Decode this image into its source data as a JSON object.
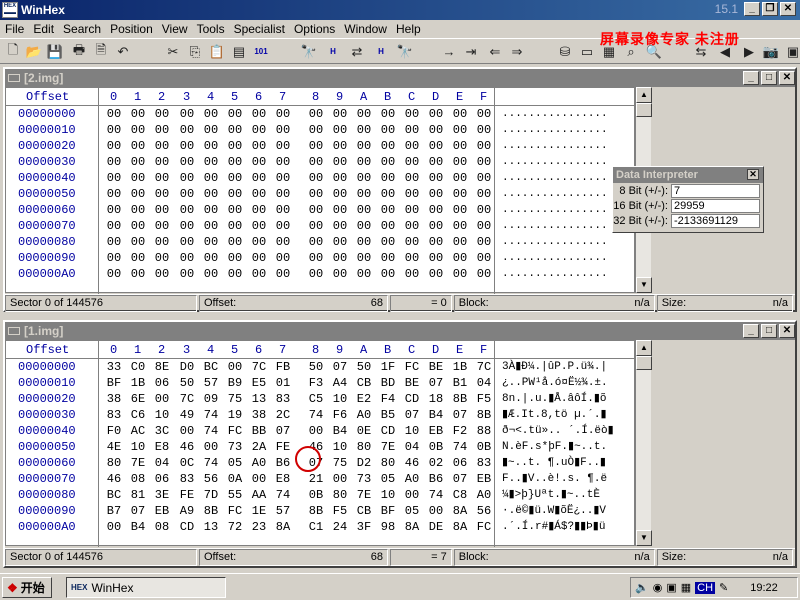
{
  "app": {
    "title": "WinHex",
    "version": "15.1",
    "icon_text": "HEX"
  },
  "menu": [
    "File",
    "Edit",
    "Search",
    "Position",
    "View",
    "Tools",
    "Specialist",
    "Options",
    "Window",
    "Help"
  ],
  "watermark": "屏幕录像专家 未注册",
  "toolbar_icons": [
    "new-file-icon",
    "open-folder-icon",
    "save-icon",
    "print-icon",
    "properties-icon",
    "undo-icon",
    "cut-icon",
    "copy-icon",
    "paste-icon",
    "write-block-icon",
    "binary-icon",
    "find-text-icon",
    "find-hex-icon",
    "replace-text-icon",
    "replace-hex-icon",
    "find-next-icon",
    "goto-offset-icon",
    "goto-sector-icon",
    "back-icon",
    "forward-icon",
    "disk-icon",
    "ram-icon",
    "calculator-icon",
    "bookmark-icon",
    "search-icon",
    "compare-icon",
    "prev-icon",
    "next-icon",
    "camera-icon",
    "view-icon"
  ],
  "hex_header": {
    "offset": "Offset",
    "columns": [
      "0",
      "1",
      "2",
      "3",
      "4",
      "5",
      "6",
      "7",
      "8",
      "9",
      "A",
      "B",
      "C",
      "D",
      "E",
      "F"
    ]
  },
  "window1": {
    "title": "[2.img]",
    "rows": [
      {
        "offset": "00000000",
        "bytes": [
          "00",
          "00",
          "00",
          "00",
          "00",
          "00",
          "00",
          "00",
          "00",
          "00",
          "00",
          "00",
          "00",
          "00",
          "00",
          "00"
        ],
        "ascii": "................"
      },
      {
        "offset": "00000010",
        "bytes": [
          "00",
          "00",
          "00",
          "00",
          "00",
          "00",
          "00",
          "00",
          "00",
          "00",
          "00",
          "00",
          "00",
          "00",
          "00",
          "00"
        ],
        "ascii": "................"
      },
      {
        "offset": "00000020",
        "bytes": [
          "00",
          "00",
          "00",
          "00",
          "00",
          "00",
          "00",
          "00",
          "00",
          "00",
          "00",
          "00",
          "00",
          "00",
          "00",
          "00"
        ],
        "ascii": "................"
      },
      {
        "offset": "00000030",
        "bytes": [
          "00",
          "00",
          "00",
          "00",
          "00",
          "00",
          "00",
          "00",
          "00",
          "00",
          "00",
          "00",
          "00",
          "00",
          "00",
          "00"
        ],
        "ascii": "................"
      },
      {
        "offset": "00000040",
        "bytes": [
          "00",
          "00",
          "00",
          "00",
          "00",
          "00",
          "00",
          "00",
          "00",
          "00",
          "00",
          "00",
          "00",
          "00",
          "00",
          "00"
        ],
        "ascii": "................"
      },
      {
        "offset": "00000050",
        "bytes": [
          "00",
          "00",
          "00",
          "00",
          "00",
          "00",
          "00",
          "00",
          "00",
          "00",
          "00",
          "00",
          "00",
          "00",
          "00",
          "00"
        ],
        "ascii": "................"
      },
      {
        "offset": "00000060",
        "bytes": [
          "00",
          "00",
          "00",
          "00",
          "00",
          "00",
          "00",
          "00",
          "00",
          "00",
          "00",
          "00",
          "00",
          "00",
          "00",
          "00"
        ],
        "ascii": "................"
      },
      {
        "offset": "00000070",
        "bytes": [
          "00",
          "00",
          "00",
          "00",
          "00",
          "00",
          "00",
          "00",
          "00",
          "00",
          "00",
          "00",
          "00",
          "00",
          "00",
          "00"
        ],
        "ascii": "................"
      },
      {
        "offset": "00000080",
        "bytes": [
          "00",
          "00",
          "00",
          "00",
          "00",
          "00",
          "00",
          "00",
          "00",
          "00",
          "00",
          "00",
          "00",
          "00",
          "00",
          "00"
        ],
        "ascii": "................"
      },
      {
        "offset": "00000090",
        "bytes": [
          "00",
          "00",
          "00",
          "00",
          "00",
          "00",
          "00",
          "00",
          "00",
          "00",
          "00",
          "00",
          "00",
          "00",
          "00",
          "00"
        ],
        "ascii": "................"
      },
      {
        "offset": "000000A0",
        "bytes": [
          "00",
          "00",
          "00",
          "00",
          "00",
          "00",
          "00",
          "00",
          "00",
          "00",
          "00",
          "00",
          "00",
          "00",
          "00",
          "00"
        ],
        "ascii": "................"
      }
    ],
    "status": {
      "sector": "Sector 0 of 144576",
      "offset_label": "Offset:",
      "offset_value": "68",
      "eq": "= 0",
      "block_label": "Block:",
      "block_value": "n/a",
      "size_label": "Size:",
      "size_value": "n/a"
    }
  },
  "window2": {
    "title": "[1.img]",
    "rows": [
      {
        "offset": "00000000",
        "bytes": [
          "33",
          "C0",
          "8E",
          "D0",
          "BC",
          "00",
          "7C",
          "FB",
          "50",
          "07",
          "50",
          "1F",
          "FC",
          "BE",
          "1B",
          "7C"
        ],
        "ascii": "3À▮Ð¼.|ûP.P.ü¾.|"
      },
      {
        "offset": "00000010",
        "bytes": [
          "BF",
          "1B",
          "06",
          "50",
          "57",
          "B9",
          "E5",
          "01",
          "F3",
          "A4",
          "CB",
          "BD",
          "BE",
          "07",
          "B1",
          "04"
        ],
        "ascii": "¿..PW¹å.ó¤Ë½¾.±."
      },
      {
        "offset": "00000020",
        "bytes": [
          "38",
          "6E",
          "00",
          "7C",
          "09",
          "75",
          "13",
          "83",
          "C5",
          "10",
          "E2",
          "F4",
          "CD",
          "18",
          "8B",
          "F5"
        ],
        "ascii": "8n.|.u.▮Å.âôÍ.▮õ"
      },
      {
        "offset": "00000030",
        "bytes": [
          "83",
          "C6",
          "10",
          "49",
          "74",
          "19",
          "38",
          "2C",
          "74",
          "F6",
          "A0",
          "B5",
          "07",
          "B4",
          "07",
          "8B"
        ],
        "ascii": "▮Æ.It.8,tö µ.´.▮"
      },
      {
        "offset": "00000040",
        "bytes": [
          "F0",
          "AC",
          "3C",
          "00",
          "74",
          "FC",
          "BB",
          "07",
          "00",
          "B4",
          "0E",
          "CD",
          "10",
          "EB",
          "F2",
          "88"
        ],
        "ascii": "ð¬<.tü».. ´.Í.ëò▮"
      },
      {
        "offset": "00000050",
        "bytes": [
          "4E",
          "10",
          "E8",
          "46",
          "00",
          "73",
          "2A",
          "FE",
          "46",
          "10",
          "80",
          "7E",
          "04",
          "0B",
          "74",
          "0B"
        ],
        "ascii": "N.èF.s*þF.▮~..t."
      },
      {
        "offset": "00000060",
        "bytes": [
          "80",
          "7E",
          "04",
          "0C",
          "74",
          "05",
          "A0",
          "B6",
          "07",
          "75",
          "D2",
          "80",
          "46",
          "02",
          "06",
          "83"
        ],
        "ascii": "▮~..t. ¶.uÒ▮F..▮"
      },
      {
        "offset": "00000070",
        "bytes": [
          "46",
          "08",
          "06",
          "83",
          "56",
          "0A",
          "00",
          "E8",
          "21",
          "00",
          "73",
          "05",
          "A0",
          "B6",
          "07",
          "EB"
        ],
        "ascii": "F..▮V..è!.s. ¶.ë"
      },
      {
        "offset": "00000080",
        "bytes": [
          "BC",
          "81",
          "3E",
          "FE",
          "7D",
          "55",
          "AA",
          "74",
          "0B",
          "80",
          "7E",
          "10",
          "00",
          "74",
          "C8",
          "A0"
        ],
        "ascii": "¼▮>þ}Uªt.▮~..tÈ "
      },
      {
        "offset": "00000090",
        "bytes": [
          "B7",
          "07",
          "EB",
          "A9",
          "8B",
          "FC",
          "1E",
          "57",
          "8B",
          "F5",
          "CB",
          "BF",
          "05",
          "00",
          "8A",
          "56"
        ],
        "ascii": "·.ë©▮ü.W▮õË¿..▮V"
      },
      {
        "offset": "000000A0",
        "bytes": [
          "00",
          "B4",
          "08",
          "CD",
          "13",
          "72",
          "23",
          "8A",
          "C1",
          "24",
          "3F",
          "98",
          "8A",
          "DE",
          "8A",
          "FC"
        ],
        "ascii": ".´.Í.r#▮Á$?▮▮Þ▮ü"
      }
    ],
    "status": {
      "sector": "Sector 0 of 144576",
      "offset_label": "Offset:",
      "offset_value": "68",
      "eq": "= 7",
      "block_label": "Block:",
      "block_value": "n/a",
      "size_label": "Size:",
      "size_value": "n/a"
    }
  },
  "interpreter": {
    "title": "Data Interpreter",
    "rows": [
      {
        "label": "8 Bit (+/-):",
        "value": "7"
      },
      {
        "label": "16 Bit (+/-):",
        "value": "29959"
      },
      {
        "label": "32 Bit (+/-):",
        "value": "-2133691129"
      }
    ]
  },
  "taskbar": {
    "start": "开始",
    "task": "WinHex",
    "lang": "CH",
    "time": "19:22"
  }
}
